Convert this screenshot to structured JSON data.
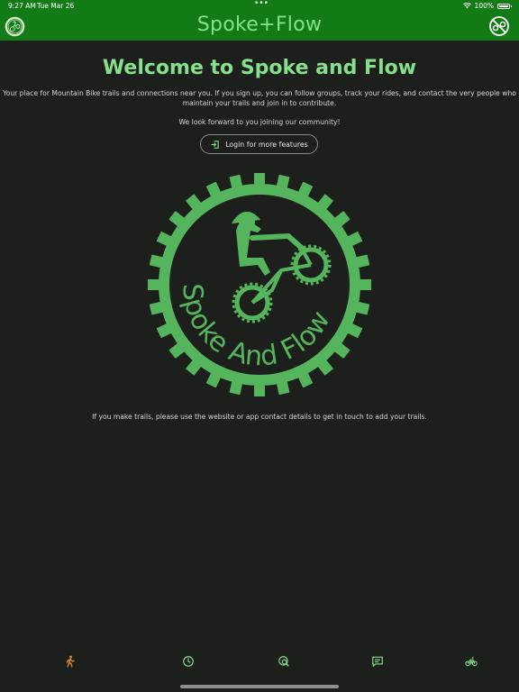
{
  "status_bar": {
    "time": "9:27 AM",
    "date": "Tue Mar 26",
    "dots": "•••",
    "battery": "100%",
    "icons": [
      "wifi-icon",
      "battery-icon"
    ]
  },
  "header": {
    "title": "Spoke+Flow",
    "logo_icon": "gear-bike-logo-icon",
    "action_icon": "no-bike-icon"
  },
  "welcome": {
    "title": "Welcome to Spoke and Flow",
    "intro_line1": "Your place for Mountain Bike trails and connections near you. If you sign up, you can follow groups, track your rides, and contact the very people who",
    "intro_line2": "maintain your trails and join in to contribute.",
    "invite": "We look forward to you joining our community!",
    "login_label": "Login for more features",
    "trail_note": "If you make trails, please use the website or app contact details to get in touch to add your trails."
  },
  "logo": {
    "text": "Spoke And Flow"
  },
  "tabs": [
    {
      "icon": "hiker-icon",
      "active": true
    },
    {
      "icon": "clock-icon",
      "active": false
    },
    {
      "icon": "map-search-icon",
      "active": false
    },
    {
      "icon": "chat-icon",
      "active": false
    },
    {
      "icon": "bicycle-icon",
      "active": false
    }
  ],
  "colors": {
    "brand_green": "#137b16",
    "accent_green": "#86e08b",
    "logo_green": "#55b55c",
    "background": "#1d1f1c",
    "active_tab": "#e0862e"
  }
}
